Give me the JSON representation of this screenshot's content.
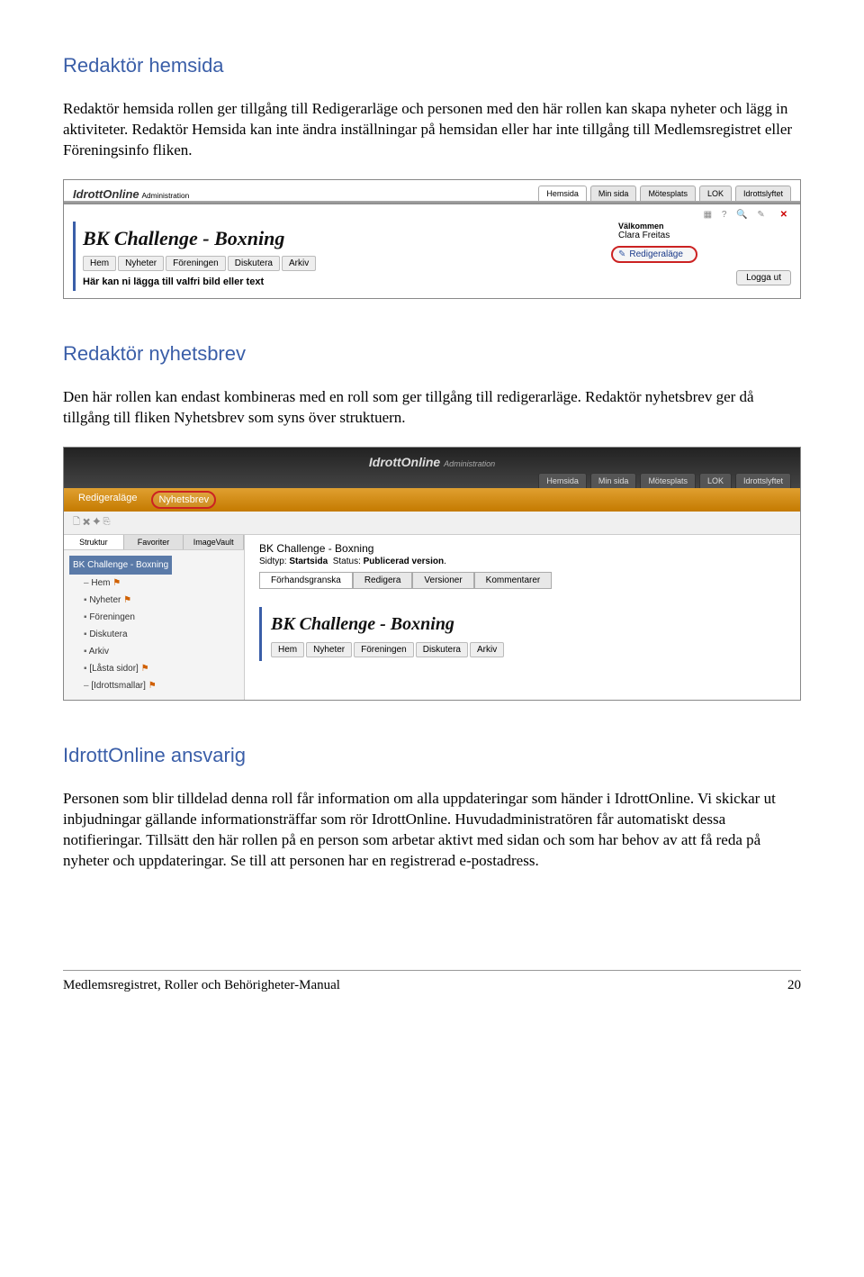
{
  "section1": {
    "heading": "Redaktör hemsida",
    "paragraph": "Redaktör hemsida rollen ger tillgång till Redigerarläge och personen med den här rollen kan skapa nyheter och lägg in aktiviteter. Redaktör Hemsida kan inte ändra inställningar på hemsidan eller har inte tillgång till Medlemsregistret eller Föreningsinfo fliken."
  },
  "screenshot1": {
    "logo": "IdrottOnline",
    "logo_sub": "Administration",
    "top_tabs": [
      "Hemsida",
      "Min sida",
      "Mötesplats",
      "LOK",
      "Idrottslyftet"
    ],
    "icons_text": "▦ ? 🔍 ✎",
    "close": "✕",
    "page_title": "BK Challenge - Boxning",
    "nav": [
      "Hem",
      "Nyheter",
      "Föreningen",
      "Diskutera",
      "Arkiv"
    ],
    "subtext": "Här kan ni lägga till valfri bild eller text",
    "welcome_label": "Välkommen",
    "welcome_name": "Clara Freitas",
    "edit_link": "Redigeraläge",
    "logout": "Logga ut"
  },
  "section2": {
    "heading": "Redaktör nyhetsbrev",
    "paragraph": "Den här rollen kan endast kombineras med en roll som ger tillgång till redigerarläge. Redaktör nyhetsbrev ger då tillgång till fliken Nyhetsbrev som syns över struktuern."
  },
  "screenshot2": {
    "logo": "IdrottOnline",
    "logo_sub": "Administration",
    "top_tabs": [
      "Hemsida",
      "Min sida",
      "Mötesplats",
      "LOK",
      "Idrottslyftet"
    ],
    "bar_items": [
      "Redigeraläge",
      "Nyhetsbrev"
    ],
    "tool_icons": "🗋  ✖  ✦  ⎘",
    "tree_tabs": [
      "Struktur",
      "Favoriter",
      "ImageVault"
    ],
    "tree_root": "BK Challenge - Boxning",
    "tree_items": [
      {
        "label": "Hem",
        "flag": true,
        "leaf": true
      },
      {
        "label": "Nyheter",
        "flag": true
      },
      {
        "label": "Föreningen"
      },
      {
        "label": "Diskutera"
      },
      {
        "label": "Arkiv"
      },
      {
        "label": "[Låsta sidor]",
        "flag": true
      },
      {
        "label": "[Idrottsmallar]",
        "flag": true,
        "leaf": true
      }
    ],
    "content_title": "BK Challenge - Boxning",
    "meta_sidtyp_label": "Sidtyp:",
    "meta_sidtyp": "Startsida",
    "meta_status_label": "Status:",
    "meta_status": "Publicerad version",
    "content_tabs": [
      "Förhandsgranska",
      "Redigera",
      "Versioner",
      "Kommentarer"
    ],
    "preview_title": "BK Challenge - Boxning",
    "preview_nav": [
      "Hem",
      "Nyheter",
      "Föreningen",
      "Diskutera",
      "Arkiv"
    ]
  },
  "section3": {
    "heading": "IdrottOnline ansvarig",
    "paragraph": "Personen som blir tilldelad denna roll får information om alla uppdateringar som händer i IdrottOnline. Vi skickar ut inbjudningar gällande informationsträffar som rör IdrottOnline. Huvudadministratören får automatiskt dessa notifieringar. Tillsätt den här rollen på en person som arbetar aktivt med sidan och som har behov av att få reda på nyheter och uppdateringar. Se till att personen har en registrerad e-postadress."
  },
  "footer": {
    "title": "Medlemsregistret, Roller och Behörigheter-Manual",
    "page": "20"
  }
}
